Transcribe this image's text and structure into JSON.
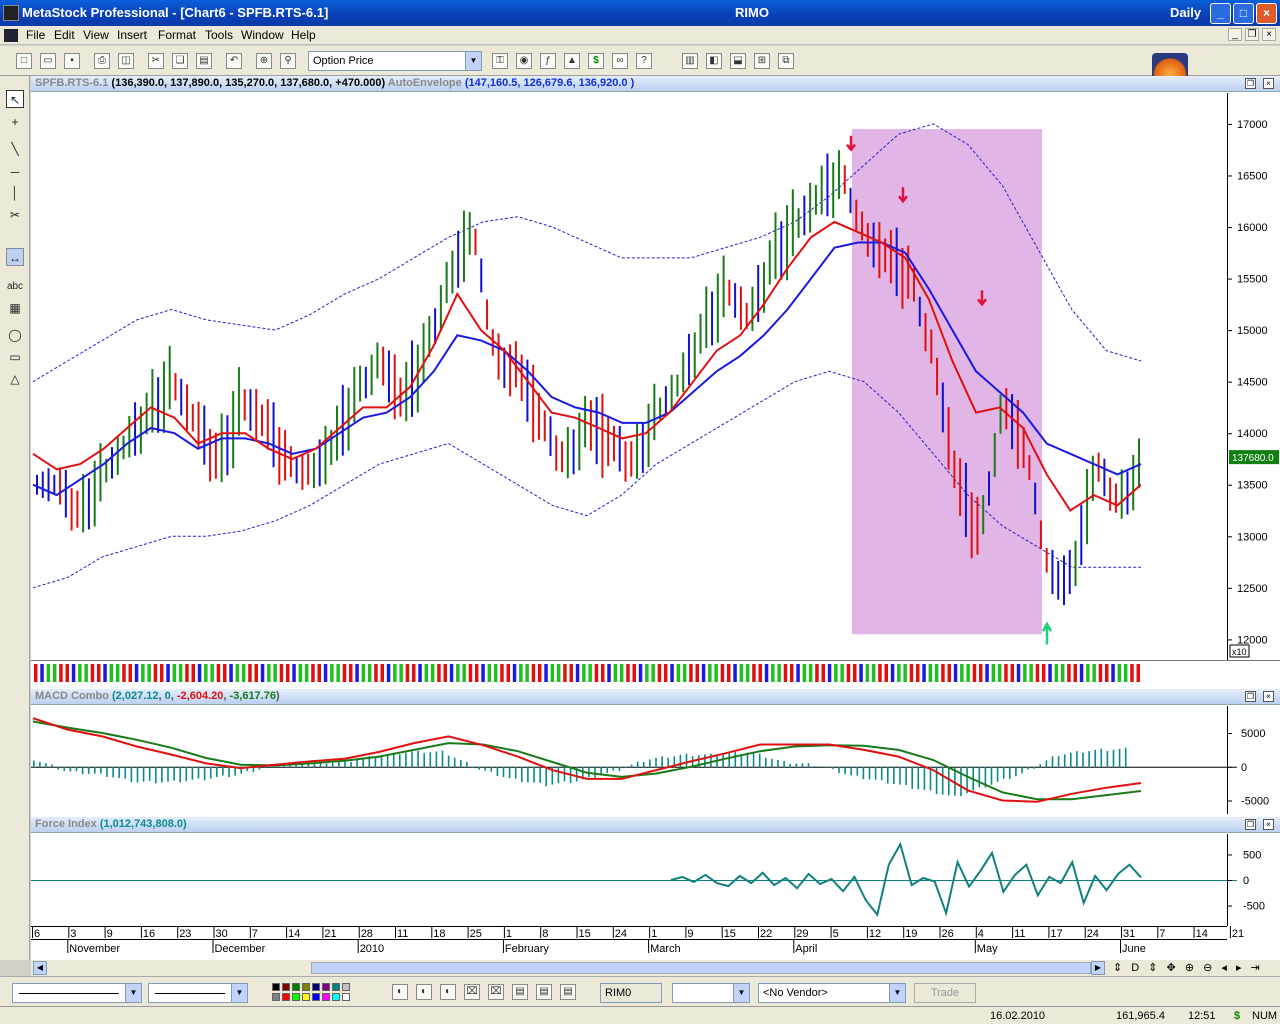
{
  "titlebar": {
    "title": "MetaStock Professional - [Chart6 - SPFB.RTS-6.1]",
    "symbol": "RIMO",
    "period": "Daily",
    "minimize": "_",
    "maximize": "□",
    "close": "×"
  },
  "menu": {
    "file": "File",
    "edit": "Edit",
    "view": "View",
    "insert": "Insert",
    "format": "Format",
    "tools": "Tools",
    "window": "Window",
    "help": "Help"
  },
  "toolbar": {
    "option_price": "Option Price"
  },
  "price_panel": {
    "security": "SPFB.RTS-6.1",
    "ohlc": "(136,390.0, 137,890.0, 135,270.0, 137,680.0, +470.000)",
    "indicator": "AutoEnvelope",
    "indicator_values": "(147,160.5, 126,679.6, 136,920.0 )",
    "last_price": "137680.0",
    "scale_multiplier": "x10"
  },
  "macd_panel": {
    "name": "MACD Combo",
    "values_a": "(",
    "v1": "2,027.12",
    "v2": "0",
    "v3": "-2,604.20",
    "v4": "-3,617.76",
    "values_b": ")"
  },
  "force_panel": {
    "name": "Force Index",
    "values": "(1,012,743,808.0)"
  },
  "colors": {
    "up": "#1a7a1a",
    "down": "#e01010",
    "neutral": "#1010d0",
    "envelope": "#2020d0",
    "shade": "#dca8e0",
    "macd_hist": "#0a8a8a",
    "force": "#108080"
  },
  "chart_data": [
    {
      "type": "ohlc",
      "title": "SPFB.RTS-6.1",
      "ylim": [
        11800,
        17300
      ],
      "yticks": [
        12000,
        12500,
        13000,
        13500,
        14000,
        14500,
        15000,
        15500,
        16000,
        16500,
        17000
      ],
      "ytick_labels": [
        "12000",
        "12500",
        "13000",
        "13500",
        "14000",
        "14500",
        "15000",
        "15500",
        "16000",
        "16500",
        "17000"
      ],
      "x_day_labels": [
        "6",
        "3",
        "9",
        "16",
        "23",
        "30",
        "7",
        "14",
        "21",
        "28",
        "11",
        "18",
        "25",
        "1",
        "8",
        "15",
        "24",
        "1",
        "9",
        "15",
        "22",
        "29",
        "5",
        "12",
        "19",
        "26",
        "4",
        "11",
        "17",
        "24",
        "31",
        "7",
        "14",
        "21"
      ],
      "x_month_labels": [
        "November",
        "December",
        "2010",
        "February",
        "March",
        "April",
        "May",
        "June"
      ],
      "series": [
        {
          "name": "Close",
          "values": [
            13500,
            13200,
            13600,
            13900,
            14200,
            14500,
            14100,
            13700,
            14300,
            14100,
            13700,
            13600,
            13900,
            14400,
            14700,
            14300,
            14800,
            15500,
            16000,
            14700,
            14600,
            14100,
            13700,
            14100,
            13900,
            13700,
            14200,
            14500,
            15000,
            15400,
            15100,
            15700,
            16000,
            16300,
            16500,
            15900,
            15700,
            15500,
            14700,
            13500,
            13000,
            14300,
            13800,
            12600,
            12600,
            13700,
            13300,
            13700
          ]
        },
        {
          "name": "EMA fast",
          "values": [
            13800,
            13650,
            13700,
            13850,
            14050,
            14250,
            14150,
            13900,
            14000,
            14000,
            13850,
            13750,
            13850,
            14050,
            14250,
            14250,
            14450,
            14850,
            15350,
            15000,
            14800,
            14500,
            14200,
            14150,
            14050,
            13950,
            14000,
            14200,
            14500,
            14800,
            14950,
            15250,
            15600,
            15900,
            16050,
            15950,
            15850,
            15700,
            15300,
            14700,
            14200,
            14250,
            14050,
            13600,
            13250,
            13400,
            13300,
            13500
          ]
        },
        {
          "name": "EMA slow",
          "values": [
            13500,
            13400,
            13550,
            13700,
            13900,
            14050,
            14000,
            13850,
            13950,
            13950,
            13900,
            13800,
            13850,
            14000,
            14150,
            14200,
            14350,
            14600,
            14950,
            14900,
            14800,
            14600,
            14350,
            14250,
            14200,
            14100,
            14100,
            14200,
            14400,
            14600,
            14750,
            14950,
            15200,
            15500,
            15800,
            15850,
            15850,
            15750,
            15400,
            15000,
            14600,
            14400,
            14200,
            13900,
            13800,
            13700,
            13600,
            13700
          ]
        },
        {
          "name": "Envelope upper",
          "values": [
            14500,
            14700,
            14900,
            15100,
            15200,
            15100,
            15050,
            15000,
            15150,
            15350,
            15500,
            15700,
            15900,
            16050,
            16100,
            16000,
            15850,
            15700,
            15700,
            15700,
            15800,
            15900,
            16050,
            16300,
            16600,
            16900,
            17000,
            16800,
            16400,
            15800,
            15200,
            14800,
            14700
          ]
        },
        {
          "name": "Envelope lower",
          "values": [
            12500,
            12600,
            12800,
            12900,
            13000,
            13000,
            13050,
            13150,
            13300,
            13500,
            13700,
            13800,
            13900,
            13700,
            13500,
            13300,
            13200,
            13400,
            13700,
            13900,
            14100,
            14300,
            14500,
            14600,
            14500,
            14200,
            13800,
            13400,
            13100,
            12900,
            12700,
            12700,
            12700
          ]
        }
      ]
    },
    {
      "type": "bar",
      "title": "MACD Combo",
      "ylim": [
        -7000,
        9000
      ],
      "yticks": [
        -5000,
        0,
        5000
      ],
      "ytick_labels": [
        "-5000",
        "0",
        "5000"
      ],
      "series": [
        {
          "name": "MACD",
          "values": [
            7200,
            5500,
            4500,
            3000,
            1800,
            500,
            -200,
            300,
            800,
            1200,
            2200,
            3500,
            4500,
            3200,
            1500,
            -500,
            -1800,
            -1800,
            -500,
            800,
            2000,
            3300,
            3300,
            3300,
            2500,
            1500,
            -500,
            -3500,
            -5000,
            -5200,
            -4000,
            -3100,
            -2400
          ]
        },
        {
          "name": "Signal",
          "values": [
            6700,
            5800,
            5000,
            4000,
            2800,
            1300,
            300,
            200,
            500,
            900,
            1500,
            2500,
            3500,
            3300,
            2300,
            700,
            -900,
            -1500,
            -1000,
            0,
            1200,
            2300,
            3000,
            3200,
            3100,
            2500,
            1000,
            -1500,
            -3800,
            -4800,
            -4800,
            -4200,
            -3600
          ]
        }
      ]
    },
    {
      "type": "line",
      "title": "Force Index",
      "ylim": [
        -900,
        900
      ],
      "yticks": [
        -500,
        0,
        500
      ],
      "ytick_labels": [
        "-500",
        "0",
        "500"
      ],
      "series": [
        {
          "name": "Force Index",
          "values": [
            0,
            60,
            -40,
            100,
            -60,
            -120,
            80,
            -60,
            140,
            -100,
            40,
            -160,
            120,
            -80,
            20,
            -220,
            60,
            -400,
            -680,
            300,
            700,
            -100,
            40,
            -30,
            -650,
            350,
            -130,
            180,
            530,
            -230,
            100,
            300,
            -300,
            60,
            -60,
            350,
            -450,
            80,
            -200,
            120,
            300,
            50
          ]
        }
      ]
    }
  ],
  "scrollbar": {
    "left": "◀",
    "right": "▶"
  },
  "bottom": {
    "ticker": "RIM0",
    "vendor": "<No Vendor>",
    "trade": "Trade"
  },
  "status": {
    "date": "16.02.2010",
    "value": "161,965.4",
    "time": "12:51",
    "dollar": "$",
    "num": "NUM"
  }
}
